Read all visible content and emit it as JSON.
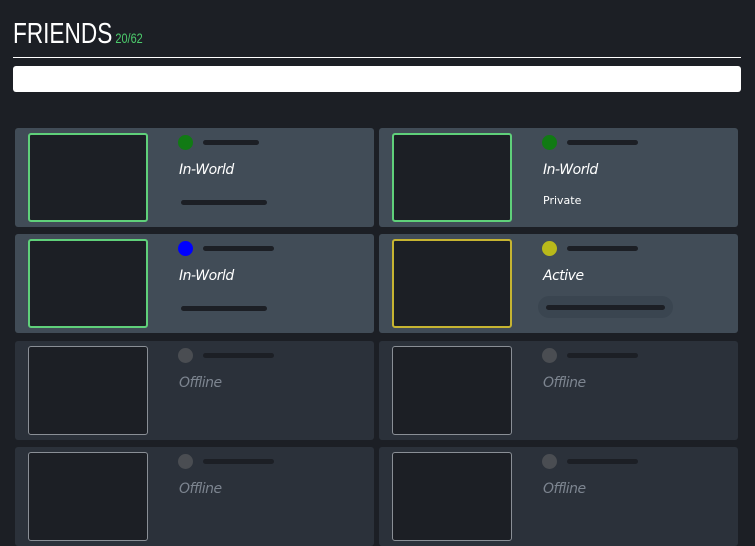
{
  "header": {
    "title": "FRIENDS",
    "count": "20/62"
  },
  "search": {
    "placeholder": ""
  },
  "friends": [
    {
      "status": "In-World",
      "dot": "#117a14",
      "border": "green",
      "sub": ""
    },
    {
      "status": "In-World",
      "dot": "#117a14",
      "border": "green",
      "sub": "Private"
    },
    {
      "status": "In-World",
      "dot": "#0000ff",
      "border": "green",
      "sub": ""
    },
    {
      "status": "Active",
      "dot": "#b9b91a",
      "border": "yellow",
      "sub": ""
    },
    {
      "status": "Offline",
      "dot": "#4a4d52",
      "border": "grey",
      "sub": ""
    },
    {
      "status": "Offline",
      "dot": "#4a4d52",
      "border": "grey",
      "sub": ""
    },
    {
      "status": "Offline",
      "dot": "#4a4d52",
      "border": "grey",
      "sub": ""
    },
    {
      "status": "Offline",
      "dot": "#4a4d52",
      "border": "grey",
      "sub": ""
    }
  ]
}
